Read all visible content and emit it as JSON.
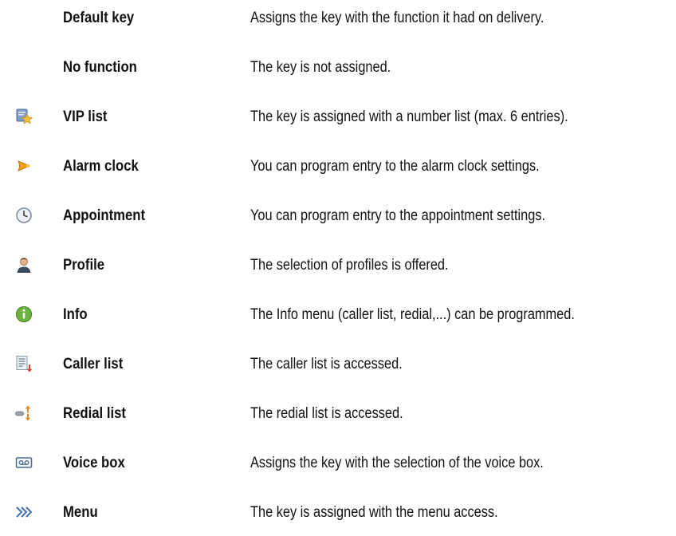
{
  "functions": [
    {
      "icon": "none",
      "name": "Default key",
      "description": "Assigns the key with the function it had on delivery."
    },
    {
      "icon": "none",
      "name": "No function",
      "description": "The key is not assigned."
    },
    {
      "icon": "vip-list-icon",
      "name": "VIP list",
      "description": "The key is assigned with a number list (max. 6 entries)."
    },
    {
      "icon": "alarm-clock-icon",
      "name": "Alarm clock",
      "description": "You can program entry to the alarm clock settings."
    },
    {
      "icon": "appointment-clock-icon",
      "name": "Appointment",
      "description": "You can program entry to the appointment settings."
    },
    {
      "icon": "profile-person-icon",
      "name": "Profile",
      "description": "The selection of profiles is offered."
    },
    {
      "icon": "info-icon",
      "name": "Info",
      "description": "The Info menu (caller list, redial,...) can be programmed."
    },
    {
      "icon": "caller-list-icon",
      "name": "Caller list",
      "description": "The caller list is accessed."
    },
    {
      "icon": "redial-list-icon",
      "name": "Redial list",
      "description": "The redial list is accessed."
    },
    {
      "icon": "voice-box-icon",
      "name": "Voice box",
      "description": "Assigns the key with the selection of the voice box."
    },
    {
      "icon": "menu-arrows-icon",
      "name": "Menu",
      "description": "The key is assigned with the menu access."
    }
  ]
}
